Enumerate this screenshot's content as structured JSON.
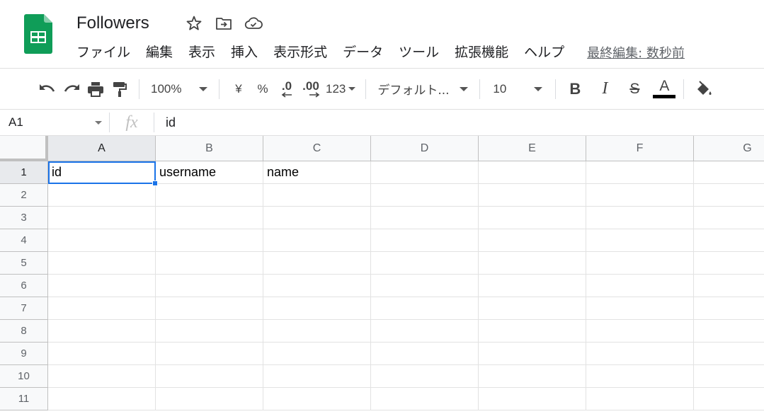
{
  "header": {
    "title": "Followers",
    "menu": [
      "ファイル",
      "編集",
      "表示",
      "挿入",
      "表示形式",
      "データ",
      "ツール",
      "拡張機能",
      "ヘルプ"
    ],
    "last_edit": "最終編集: 数秒前",
    "icons": [
      "star-icon",
      "move-folder-icon",
      "cloud-status-icon"
    ]
  },
  "toolbar": {
    "zoom": "100%",
    "currency": "¥",
    "percent": "%",
    "decrease_decimal": ".0",
    "increase_decimal": ".00",
    "number_format": "123",
    "font": "デフォルト...",
    "font_size": "10",
    "bold": "B",
    "italic": "I",
    "strike": "S",
    "text_color": "A",
    "text_color_value": "#000000"
  },
  "formula_bar": {
    "cell_ref": "A1",
    "fx": "fx",
    "value": "id"
  },
  "sheet": {
    "columns": [
      "A",
      "B",
      "C",
      "D",
      "E",
      "F",
      "G"
    ],
    "rows": [
      "1",
      "2",
      "3",
      "4",
      "5",
      "6",
      "7",
      "8",
      "9",
      "10",
      "11"
    ],
    "cells": {
      "A1": "id",
      "B1": "username",
      "C1": "name"
    },
    "selected": "A1",
    "accent": "#1a73e8"
  }
}
